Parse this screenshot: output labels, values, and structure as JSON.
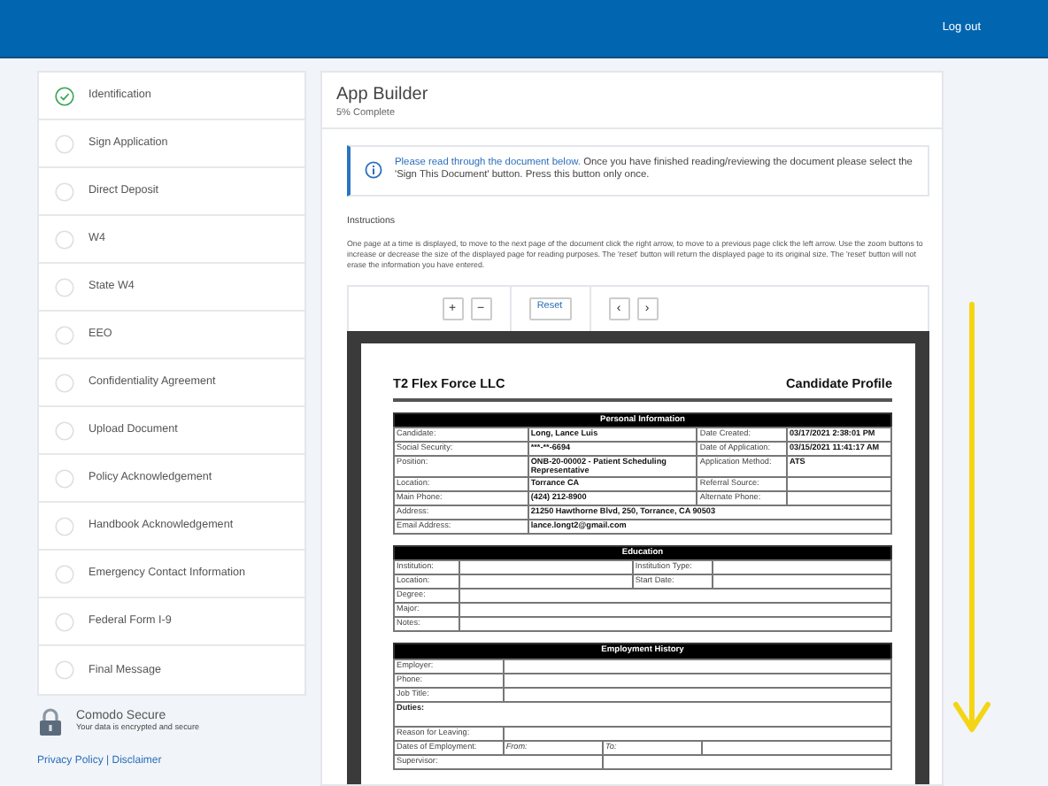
{
  "header": {
    "logout": "Log out"
  },
  "sidebar": {
    "steps": [
      {
        "label": "Identification",
        "completed": true
      },
      {
        "label": "Sign Application",
        "completed": false
      },
      {
        "label": "Direct Deposit",
        "completed": false
      },
      {
        "label": "W4",
        "completed": false
      },
      {
        "label": "State W4",
        "completed": false
      },
      {
        "label": "EEO",
        "completed": false
      },
      {
        "label": "Confidentiality Agreement",
        "completed": false
      },
      {
        "label": "Upload Document",
        "completed": false
      },
      {
        "label": "Policy Acknowledgement",
        "completed": false
      },
      {
        "label": "Handbook Acknowledgement",
        "completed": false
      },
      {
        "label": "Emergency Contact Information",
        "completed": false
      },
      {
        "label": "Federal Form I-9",
        "completed": false
      },
      {
        "label": "Final Message",
        "completed": false
      }
    ]
  },
  "secure": {
    "title": "Comodo Secure",
    "subtitle": "Your data is encrypted and secure"
  },
  "footer_links": {
    "links": [
      "Privacy Policy",
      "Disclaimer"
    ],
    "separator": "|"
  },
  "main": {
    "title": "App Builder",
    "subtitle": "5% Complete",
    "alert": {
      "highlight": "Please read through the document below.",
      "text": "Once you have finished reading/reviewing the document please select the 'Sign This Document' button. Press this button only once."
    },
    "instructions_label": "Instructions",
    "instructions_text": "One page at a time is displayed, to move to the next page of the document click the right arrow, to move to a previous page click the left arrow. Use the zoom buttons to increase or decrease the size of the displayed page for reading purposes. The 'reset' button will return the displayed page to its original size. The 'reset' button will not erase the information you have entered.",
    "toolbar": {
      "zoom_in": "+",
      "zoom_out": "−",
      "reset": "Reset",
      "previous": "‹",
      "next": "›"
    },
    "document": {
      "company": "T2 Flex Force LLC",
      "title": "Candidate Profile",
      "sections": [
        {
          "heading": "Personal Information",
          "fields": [
            {
              "kind": "pairs",
              "label": "Candidate:",
              "value": "Long, Lance Luis",
              "label_2": "Date Created:",
              "value_2": "03/17/2021 2:38:01 PM"
            },
            {
              "kind": "pairs",
              "label": "Social Security:",
              "value": "***-**-6694",
              "label_2": "Date of Application:",
              "value_2": "03/15/2021 11:41:17 AM"
            },
            {
              "kind": "pairs",
              "label": "Position:",
              "value": "ONB-20-00002 - Patient Scheduling Representative",
              "label_2": "Application Method:",
              "value_2": "ATS"
            },
            {
              "kind": "pairs",
              "label": "Location:",
              "value": "Torrance CA",
              "label_2": "Referral Source:"
            },
            {
              "kind": "pairs",
              "label": "Main Phone:",
              "value": "(424) 212-8900",
              "label_2": "Alternate Phone:"
            },
            {
              "kind": "wide",
              "label": "Address:",
              "value": "21250 Hawthorne Blvd, 250, Torrance, CA 90503"
            },
            {
              "kind": "wide",
              "label": "Email Address:",
              "value": "lance.longt2@gmail.com"
            }
          ]
        },
        {
          "heading": "Education",
          "fields": [
            {
              "kind": "pairs",
              "label": "Institution:",
              "label_2": "Institution Type:"
            },
            {
              "kind": "pairs",
              "label": "Location:",
              "label_2": "Start Date:"
            },
            {
              "kind": "wide",
              "label": "Degree:"
            },
            {
              "kind": "wide",
              "label": "Major:"
            },
            {
              "kind": "wide",
              "label": "Notes:"
            }
          ]
        },
        {
          "heading": "Employment History",
          "fields": [
            {
              "kind": "wide",
              "label": "Employer:"
            },
            {
              "kind": "wide",
              "label": "Phone:"
            },
            {
              "kind": "wide",
              "label": "Job Title:"
            },
            {
              "kind": "full",
              "label": "Duties:"
            },
            {
              "kind": "wide",
              "label": "Reason for Leaving:"
            },
            {
              "kind": "dates",
              "label": "Dates of Employment:",
              "from": "From:",
              "to": "To:"
            },
            {
              "kind": "halves",
              "label": "Supervisor:"
            }
          ]
        }
      ]
    }
  }
}
